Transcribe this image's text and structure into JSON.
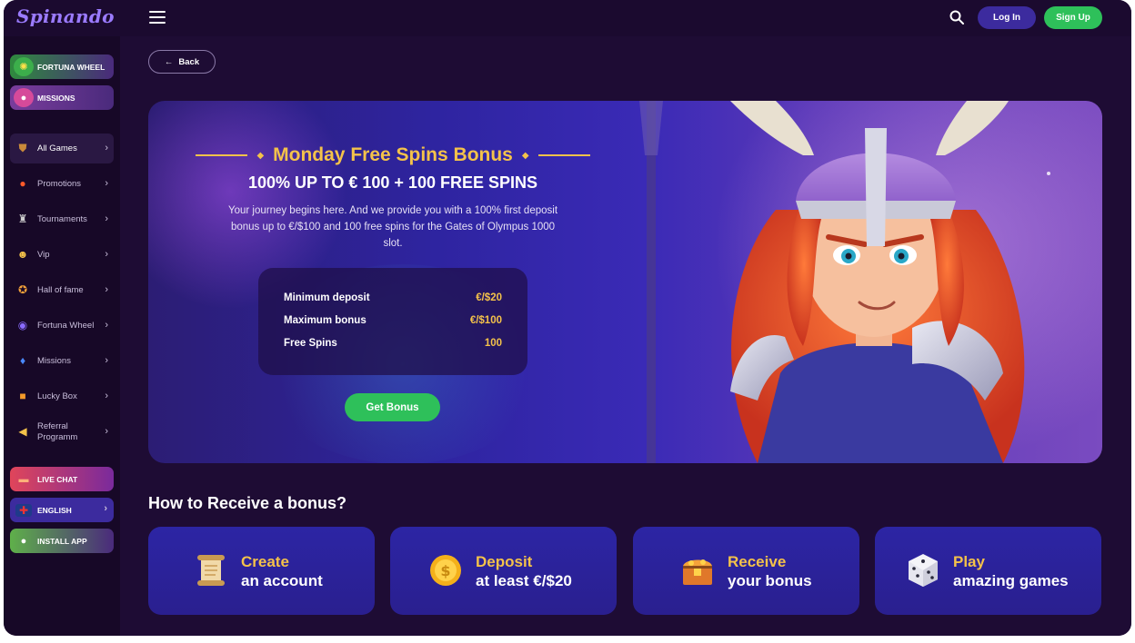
{
  "header": {
    "logo": "Spinando",
    "login_label": "Log In",
    "signup_label": "Sign Up"
  },
  "sidebar": {
    "promo_top": [
      {
        "label": "FORTUNA WHEEL",
        "icon": "wheel-icon",
        "color": "#2f8a3e"
      },
      {
        "label": "MISSIONS",
        "icon": "potion-icon",
        "color": "#7a3d9c"
      }
    ],
    "items": [
      {
        "label": "All Games",
        "icon": "shield-icon"
      },
      {
        "label": "Promotions",
        "icon": "fire-icon"
      },
      {
        "label": "Tournaments",
        "icon": "trophy-icon"
      },
      {
        "label": "Vip",
        "icon": "vip-icon"
      },
      {
        "label": "Hall of fame",
        "icon": "medal-icon"
      },
      {
        "label": "Fortuna Wheel",
        "icon": "wheel-icon"
      },
      {
        "label": "Missions",
        "icon": "potion-icon"
      },
      {
        "label": "Lucky Box",
        "icon": "box-icon"
      },
      {
        "label": "Referral Programm",
        "icon": "megaphone-icon"
      }
    ],
    "promo_bottom": [
      {
        "label": "LIVE CHAT",
        "icon": "chat-icon"
      },
      {
        "label": "ENGLISH",
        "icon": "uk-flag-icon"
      },
      {
        "label": "INSTALL APP",
        "icon": "apple-android-icon"
      }
    ]
  },
  "main": {
    "back_label": "Back",
    "hero": {
      "title": "Monday Free Spins Bonus",
      "subtitle": "100% UP TO € 100 + 100 FREE SPINS",
      "description": "Your journey begins here. And we provide you with a 100% first deposit bonus up to €/$100 and 100 free spins for the Gates of Olympus 1000 slot.",
      "terms": [
        {
          "key": "Minimum deposit",
          "value": "€/$20"
        },
        {
          "key": "Maximum bonus",
          "value": "€/$100"
        },
        {
          "key": "Free Spins",
          "value": "100"
        }
      ],
      "cta_label": "Get Bonus"
    },
    "how_title": "How to Receive a bonus?",
    "steps": [
      {
        "line1": "Create",
        "line2": "an account",
        "icon": "scroll-icon"
      },
      {
        "line1": "Deposit",
        "line2": "at least €/$20",
        "icon": "coin-icon"
      },
      {
        "line1": "Receive",
        "line2": "your bonus",
        "icon": "treasure-chest-icon"
      },
      {
        "line1": "Play",
        "line2": "amazing games",
        "icon": "dice-icon"
      }
    ]
  },
  "colors": {
    "accent_gold": "#f4c24a",
    "accent_green": "#2ec05a",
    "accent_purple": "#3c2b9e",
    "background": "#1e0c34"
  }
}
